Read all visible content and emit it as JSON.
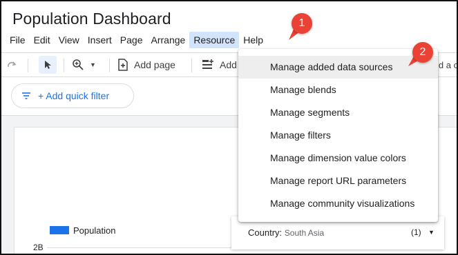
{
  "app": {
    "title": "Population Dashboard"
  },
  "menubar": {
    "items": [
      "File",
      "Edit",
      "View",
      "Insert",
      "Page",
      "Arrange",
      "Resource",
      "Help"
    ],
    "active": "Resource"
  },
  "toolbar": {
    "add_page_label": "Add page",
    "add_data_label": "Add",
    "trailing_text": "ld a c"
  },
  "quick_filter": {
    "label": "+ Add quick filter"
  },
  "report": {
    "legend_label": "Population",
    "axis_tick": "2B",
    "control": {
      "dimension": "Country:",
      "value": "South Asia",
      "count": "(1)"
    }
  },
  "resource_menu": {
    "items": [
      "Manage added data sources",
      "Manage blends",
      "Manage segments",
      "Manage filters",
      "Manage dimension value colors",
      "Manage report URL parameters",
      "Manage community visualizations"
    ]
  },
  "callouts": {
    "one": "1",
    "two": "2"
  },
  "colors": {
    "accent": "#1a73e8",
    "callout": "#ea4335",
    "active_menu": "#d2e3fc"
  }
}
